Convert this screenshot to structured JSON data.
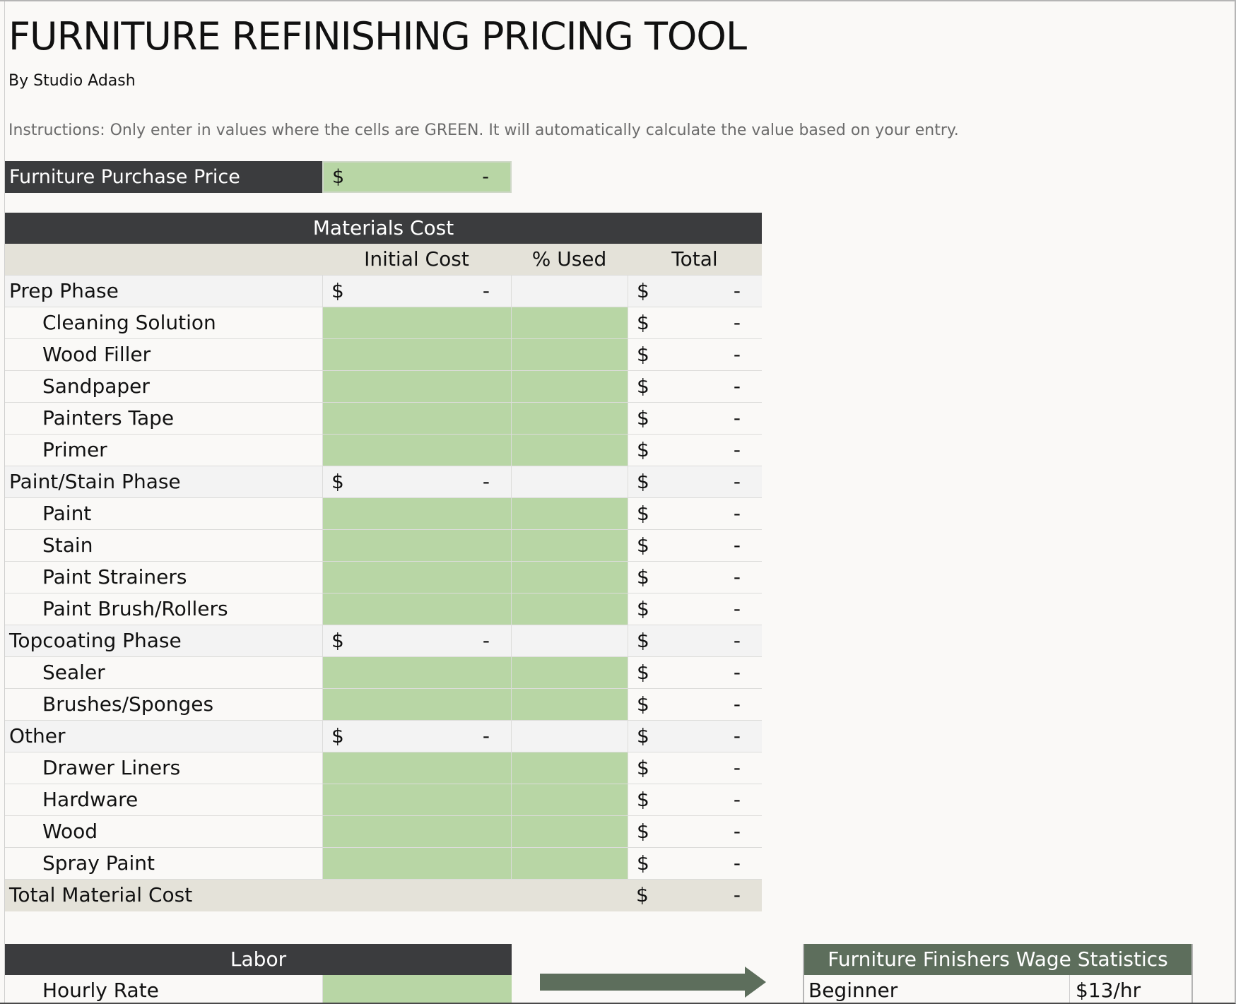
{
  "title": "FURNITURE REFINISHING PRICING TOOL",
  "byline": "By Studio Adash",
  "instructions": "Instructions:  Only enter in values where the cells are GREEN.  It will automatically calculate the value based on your entry.",
  "purchase": {
    "label": "Furniture Purchase Price",
    "currency": "$",
    "value": "-"
  },
  "materials": {
    "title": "Materials Cost",
    "columns": [
      "",
      "Initial Cost",
      "% Used",
      "Total"
    ],
    "rows": [
      {
        "kind": "phase",
        "label": "Prep Phase",
        "initial": "-",
        "total": "-"
      },
      {
        "kind": "item",
        "label": "Cleaning Solution",
        "total": "-"
      },
      {
        "kind": "item",
        "label": "Wood Filler",
        "total": "-"
      },
      {
        "kind": "item",
        "label": "Sandpaper",
        "total": "-"
      },
      {
        "kind": "item",
        "label": "Painters Tape",
        "total": "-"
      },
      {
        "kind": "item",
        "label": "Primer",
        "total": "-"
      },
      {
        "kind": "phase",
        "label": "Paint/Stain Phase",
        "initial": "-",
        "total": "-"
      },
      {
        "kind": "item",
        "label": "Paint",
        "total": "-"
      },
      {
        "kind": "item",
        "label": "Stain",
        "total": "-"
      },
      {
        "kind": "item",
        "label": "Paint Strainers",
        "total": "-"
      },
      {
        "kind": "item",
        "label": "Paint Brush/Rollers",
        "total": "-"
      },
      {
        "kind": "phase",
        "label": "Topcoating Phase",
        "initial": "-",
        "total": "-"
      },
      {
        "kind": "item",
        "label": "Sealer",
        "total": "-"
      },
      {
        "kind": "item",
        "label": "Brushes/Sponges",
        "total": "-"
      },
      {
        "kind": "phase",
        "label": "Other",
        "initial": "-",
        "total": "-"
      },
      {
        "kind": "item",
        "label": "Drawer Liners",
        "total": "-"
      },
      {
        "kind": "item",
        "label": "Hardware",
        "total": "-"
      },
      {
        "kind": "item",
        "label": "Wood",
        "total": "-"
      },
      {
        "kind": "item",
        "label": "Spray Paint",
        "total": "-"
      }
    ],
    "total_row": {
      "label": "Total Material Cost",
      "total": "-"
    },
    "currency": "$"
  },
  "labor": {
    "title": "Labor",
    "rows": [
      {
        "label": "Hourly Rate"
      }
    ]
  },
  "wage": {
    "title": "Furniture Finishers Wage Statistics",
    "rows": [
      {
        "level": "Beginner",
        "rate": "$13/hr"
      }
    ]
  },
  "colors": {
    "header_dark": "#3b3c3e",
    "input_green": "#b8d6a5",
    "wage_header": "#5d6e5c",
    "arrow": "#5d6e5c",
    "column_header_bg": "#e4e2d9"
  }
}
